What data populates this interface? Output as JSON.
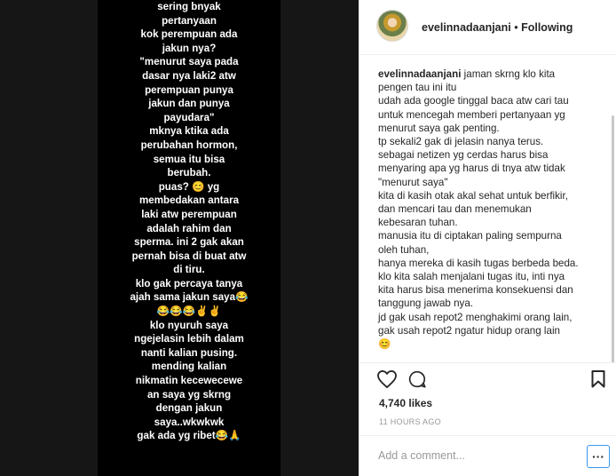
{
  "post": {
    "story_lines": [
      "sering bnyak",
      "pertanyaan",
      "kok perempuan ada",
      "jakun nya?",
      "\"menurut saya pada",
      "dasar nya laki2 atw",
      "perempuan punya",
      "jakun dan punya",
      "payudara\"",
      "mknya ktika ada",
      "perubahan hormon,",
      "semua itu bisa",
      "berubah.",
      "puas? 😊 yg",
      "membedakan antara",
      "laki atw perempuan",
      "adalah rahim dan",
      "sperma.  ini 2 gak akan",
      "pernah bisa di buat atw",
      "di tiru.",
      "klo gak percaya tanya",
      "ajah sama jakun saya😂",
      "😂😂😂✌✌",
      "klo nyuruh saya",
      "ngejelasin lebih dalam",
      "nanti kalian pusing.",
      "mending kalian",
      "nikmatin kecewecewe",
      "an saya yg skrng",
      "dengan jakun",
      "saya..wkwkwk",
      "gak ada yg ribet😂🙏"
    ]
  },
  "header": {
    "username": "evelinnadaanjani",
    "separator": "•",
    "follow_status": "Following"
  },
  "caption": {
    "username": "evelinnadaanjani",
    "first_line": "jaman skrng klo kita",
    "lines": [
      "pengen tau ini itu",
      "udah ada google tinggal baca atw cari tau",
      "untuk mencegah memberi pertanyaan yg",
      "menurut saya gak penting.",
      "tp sekali2 gak di jelasin nanya terus.",
      "sebagai netizen yg cerdas harus bisa",
      "menyaring apa yg harus di tnya atw tidak",
      "\"menurut saya\"",
      "kita di kasih otak akal sehat untuk berfikir,",
      "dan mencari tau dan menemukan",
      "kebesaran tuhan.",
      "manusia itu di ciptakan paling sempurna",
      "oleh tuhan,",
      "hanya mereka di kasih tugas berbeda beda.",
      "klo kita salah menjalani tugas itu, inti nya",
      "kita harus bisa menerima konsekuensi dan",
      "tanggung jawab nya.",
      "jd gak usah repot2 menghakimi orang lain,",
      "gak usah repot2 ngatur hidup orang lain",
      "😊"
    ]
  },
  "actions": {
    "icons": [
      "heart-icon",
      "comment-icon",
      "bookmark-icon"
    ]
  },
  "likes": "4,740 likes",
  "timestamp": "11 HOURS AGO",
  "comment": {
    "placeholder": "Add a comment...",
    "more_label": "···"
  }
}
